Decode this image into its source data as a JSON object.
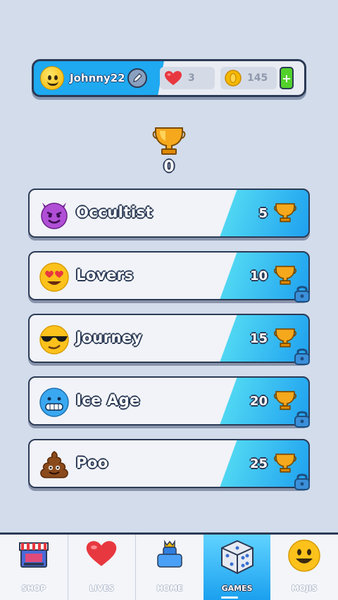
{
  "profile": {
    "username": "Johnny22",
    "lives": "3",
    "coins": "145",
    "plus_label": "+"
  },
  "trophies": {
    "total": "0"
  },
  "levels": [
    {
      "name": "Occultist",
      "required": "5",
      "emoji": "devil-icon",
      "locked": false
    },
    {
      "name": "Lovers",
      "required": "10",
      "emoji": "heart-eyes-icon",
      "locked": true
    },
    {
      "name": "Journey",
      "required": "15",
      "emoji": "sunglasses-icon",
      "locked": true
    },
    {
      "name": "Ice Age",
      "required": "20",
      "emoji": "cold-face-icon",
      "locked": true
    },
    {
      "name": "Poo",
      "required": "25",
      "emoji": "poo-icon",
      "locked": true
    }
  ],
  "nav": {
    "items": [
      {
        "label": "SHOP",
        "icon": "shop-icon"
      },
      {
        "label": "LIVES",
        "icon": "heart-icon"
      },
      {
        "label": "HOME",
        "icon": "home-icon"
      },
      {
        "label": "GAMES",
        "icon": "dice-icon",
        "active": true
      },
      {
        "label": "MOJIS",
        "icon": "smiley-icon"
      }
    ]
  },
  "colors": {
    "accent_blue": "#1fa9f0",
    "outline": "#2b3a55",
    "background": "#d2dceb",
    "trophy_gold": "#f5a81c",
    "plus_green": "#52d12b"
  }
}
